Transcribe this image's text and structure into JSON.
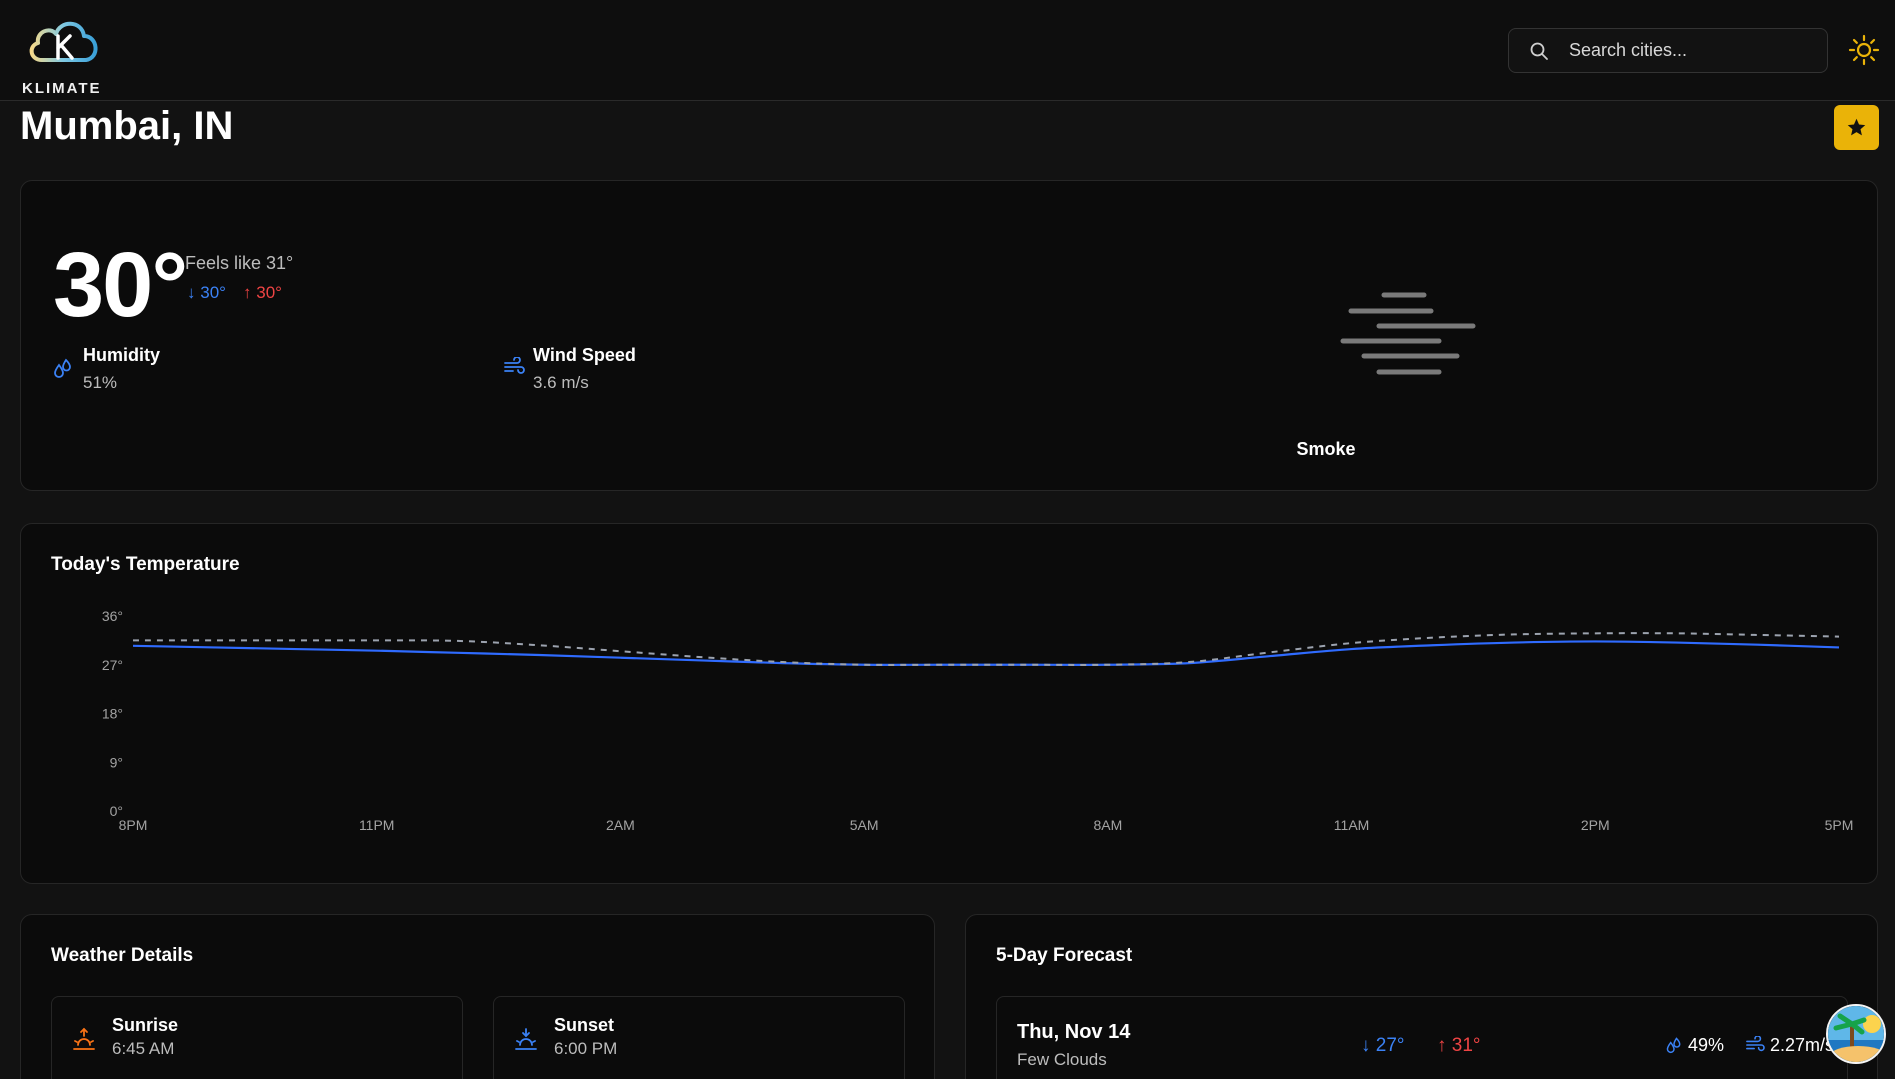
{
  "header": {
    "logo_text": "KLIMATE",
    "search_placeholder": "Search cities..."
  },
  "location": {
    "title": "Mumbai, IN"
  },
  "current": {
    "temperature": "30°",
    "feels_like": "Feels like 31°",
    "temp_min": "30°",
    "temp_max": "30°",
    "humidity_label": "Humidity",
    "humidity_value": "51%",
    "wind_label": "Wind Speed",
    "wind_value": "3.6 m/s",
    "condition": "Smoke"
  },
  "chart_section": {
    "title": "Today's Temperature"
  },
  "chart_data": {
    "type": "line",
    "title": "Today's Temperature",
    "x": [
      "8PM",
      "9PM",
      "10PM",
      "11PM",
      "12AM",
      "1AM",
      "2AM",
      "3AM",
      "4AM",
      "5AM",
      "6AM",
      "7AM",
      "8AM",
      "9AM",
      "10AM",
      "11AM",
      "12PM",
      "1PM",
      "2PM",
      "3PM",
      "4PM",
      "5PM"
    ],
    "x_tick_labels": [
      "8PM",
      "11PM",
      "2AM",
      "5AM",
      "8AM",
      "11AM",
      "2PM",
      "5PM"
    ],
    "y_tick_labels": [
      "0°",
      "9°",
      "18°",
      "27°",
      "36°"
    ],
    "ylim": [
      0,
      36
    ],
    "series": [
      {
        "values": [
          30.5,
          30.2,
          29.9,
          29.6,
          29.2,
          28.8,
          28.3,
          27.8,
          27.3,
          27.0,
          27.0,
          27.0,
          27.0,
          27.3,
          28.6,
          29.9,
          30.6,
          31.1,
          31.3,
          31.1,
          30.7,
          30.2
        ]
      },
      {
        "values": [
          31.5,
          31.5,
          31.5,
          31.5,
          31.4,
          30.6,
          29.5,
          28.4,
          27.5,
          27.0,
          27.0,
          27.0,
          27.0,
          27.5,
          29.3,
          31.0,
          32.0,
          32.6,
          32.8,
          32.8,
          32.5,
          32.2
        ]
      }
    ],
    "colors": [
      "#2f6bff",
      "#9ca3af"
    ],
    "grid": false
  },
  "details": {
    "title": "Weather Details",
    "sunrise_label": "Sunrise",
    "sunrise_value": "6:45 AM",
    "sunset_label": "Sunset",
    "sunset_value": "6:00 PM"
  },
  "forecast": {
    "title": "5-Day Forecast",
    "days": [
      {
        "date": "Thu, Nov 14",
        "description": "Few Clouds",
        "min": "27°",
        "max": "31°",
        "humidity": "49%",
        "wind": "2.27m/s"
      }
    ]
  },
  "colors": {
    "accent": "#eab308",
    "cold": "#3b82f6",
    "hot": "#ef4444"
  }
}
